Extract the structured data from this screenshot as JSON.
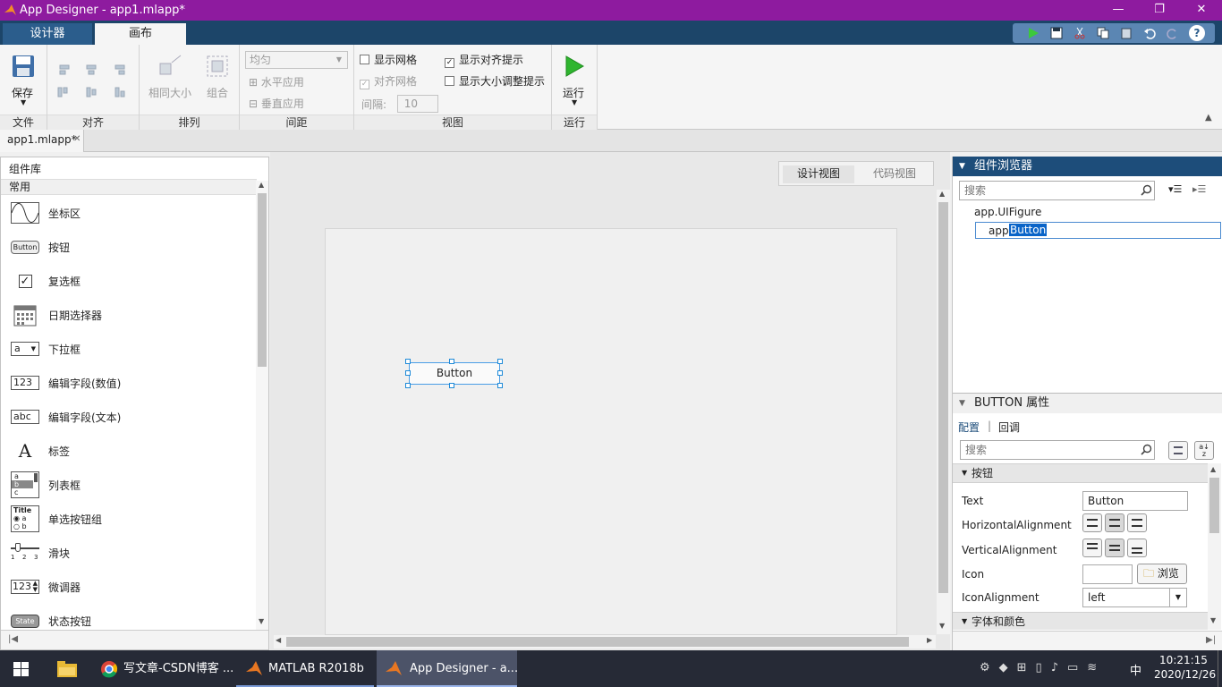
{
  "window": {
    "title": "App Designer - app1.mlapp*"
  },
  "top_tabs": [
    "设计器",
    "画布"
  ],
  "ribbon": {
    "file": {
      "save_label": "保存",
      "section": "文件"
    },
    "align": {
      "section": "对齐"
    },
    "arrange": {
      "same_size": "相同大小",
      "group": "组合",
      "section": "排列"
    },
    "spacing": {
      "dropdown": "均匀",
      "apply_h": "水平应用",
      "apply_v": "垂直应用",
      "gap_label": "间隔:",
      "gap_value": "10",
      "section": "间距"
    },
    "view": {
      "show_grid": "显示网格",
      "snap_grid": "对齐网格",
      "show_align": "显示对齐提示",
      "show_resize": "显示大小调整提示",
      "section": "视图"
    },
    "run": {
      "label": "运行",
      "section": "运行"
    }
  },
  "doc_tab": "app1.mlapp*",
  "library": {
    "title": "组件库",
    "category": "常用",
    "items": [
      "坐标区",
      "按钮",
      "复选框",
      "日期选择器",
      "下拉框",
      "编辑字段(数值)",
      "编辑字段(文本)",
      "标签",
      "列表框",
      "单选按钮组",
      "滑块",
      "微调器",
      "状态按钮"
    ],
    "icon_text": {
      "button": "Button",
      "dropdown": "a",
      "numeric": "123",
      "text": "abc",
      "label": "A",
      "list": [
        "a",
        "b",
        "c"
      ],
      "radio": [
        "Title",
        "a",
        "b"
      ],
      "slider": [
        "1",
        "2",
        "3"
      ],
      "spinner": "123",
      "state": "State"
    }
  },
  "canvas": {
    "views": [
      "设计视图",
      "代码视图"
    ],
    "button_text": "Button"
  },
  "browser": {
    "title": "组件浏览器",
    "search_placeholder": "搜索",
    "root": "app.UIFigure",
    "child_prefix": "app.",
    "child_name": "Button"
  },
  "props": {
    "title": "BUTTON 属性",
    "tabs": [
      "配置",
      "回调"
    ],
    "search_placeholder": "搜索",
    "section": "按钮",
    "next_section": "字体和颜色",
    "rows": [
      {
        "label": "Text",
        "value": "Button"
      },
      {
        "label": "HorizontalAlignment"
      },
      {
        "label": "VerticalAlignment"
      },
      {
        "label": "Icon",
        "browse": "浏览"
      },
      {
        "label": "IconAlignment",
        "value": "left"
      }
    ]
  },
  "taskbar": {
    "items": [
      "写文章-CSDN博客 ...",
      "MATLAB R2018b",
      "App Designer - a..."
    ],
    "time": "10:21:15",
    "date": "2020/12/26",
    "ime": "中"
  },
  "colors": {
    "title": "#8e1b9f",
    "tabbar": "#1c4569",
    "panel_header": "#1d4d7a",
    "selection": "#0a64c8"
  }
}
